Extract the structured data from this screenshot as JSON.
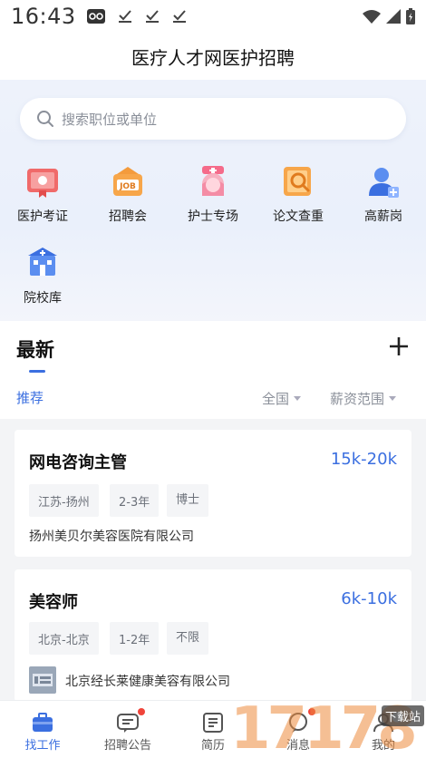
{
  "status_bar": {
    "time": "16:43"
  },
  "header": {
    "title": "医疗人才网医护招聘"
  },
  "search": {
    "placeholder": "搜索职位或单位"
  },
  "quick_entries": [
    {
      "label": "医护考证",
      "icon": "certificate-icon"
    },
    {
      "label": "招聘会",
      "icon": "job-fair-icon"
    },
    {
      "label": "护士专场",
      "icon": "nurse-icon"
    },
    {
      "label": "论文查重",
      "icon": "paper-check-icon"
    },
    {
      "label": "高薪岗",
      "icon": "high-salary-icon"
    },
    {
      "label": "院校库",
      "icon": "school-icon"
    }
  ],
  "latest": {
    "title": "最新",
    "tab": "推荐",
    "filter_region": "全国",
    "filter_salary": "薪资范围"
  },
  "jobs": [
    {
      "title": "网电咨询主管",
      "salary": "15k-20k",
      "tags": [
        "江苏-扬州",
        "2-3年",
        "博士"
      ],
      "company": "扬州美贝尔美容医院有限公司"
    },
    {
      "title": "美容师",
      "salary": "6k-10k",
      "tags": [
        "北京-北京",
        "1-2年",
        "不限"
      ],
      "company": "北京经长莱健康美容有限公司"
    }
  ],
  "tabbar": [
    {
      "label": "找工作",
      "icon": "briefcase-icon",
      "active": true
    },
    {
      "label": "招聘公告",
      "icon": "announcement-icon"
    },
    {
      "label": "简历",
      "icon": "resume-icon"
    },
    {
      "label": "消息",
      "icon": "message-icon"
    },
    {
      "label": "我的",
      "icon": "profile-icon"
    }
  ],
  "watermark": {
    "text": "17178",
    "badge": "下载站"
  },
  "colors": {
    "accent": "#3b6fe0",
    "badge": "#f0443a"
  }
}
